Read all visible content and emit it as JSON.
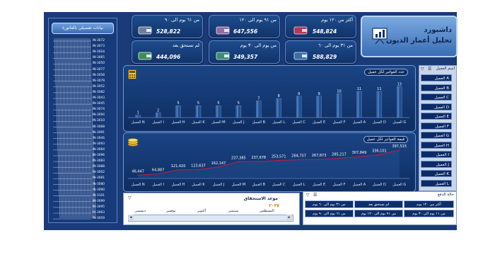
{
  "header": {
    "line1": "داشبورد",
    "line2": "تحلیل أعمار الدیون"
  },
  "kpis": [
    {
      "label": "أكثر من ١٢٠ يوم",
      "value": "548,824"
    },
    {
      "label": "من ٩١ يوم الى ١٢٠",
      "value": "647,556"
    },
    {
      "label": "من ٦١ يوم الى ٩٠",
      "value": "528,822"
    },
    {
      "label": "من ٣١ يوم الى ٦٠",
      "value": "588,829"
    },
    {
      "label": "من يوم الى ٣٠ يوم",
      "value": "349,357"
    },
    {
      "label": "لم تستحق بعد",
      "value": "444,096"
    }
  ],
  "invoice_panel": {
    "title": "بيانات تفصيلي بالفاتورة",
    "items": [
      "IN-3072",
      "IN-3073",
      "IN-3024",
      "IN-3065",
      "IN-3050",
      "IN-3077",
      "IN-3058",
      "IN-3079",
      "IN-3052",
      "IN-3082",
      "IN-3043",
      "IN-3045",
      "IN-3074",
      "IN-3094",
      "IN-3010",
      "IN-3068",
      "IN-3091",
      "IN-3046",
      "IN-3093",
      "IN-3064",
      "IN-3096",
      "IN-3083",
      "IN-3088",
      "IN-3002",
      "IN-3081",
      "IN-3080",
      "IN-3090",
      "IN-3101",
      "IN-3099",
      "IN-3095",
      "IN-3063",
      "IN-3059"
    ]
  },
  "client_slicer": {
    "title": "اسم العميل",
    "items": [
      "العميل A",
      "العميل B",
      "العميل C",
      "العميل D",
      "العميل E",
      "العميل F",
      "العميل G",
      "العميل H",
      "العميل I",
      "العميل J",
      "العميل K",
      "العميل L"
    ]
  },
  "count_chart": {
    "title": "عدد الفواتير لكل عميل"
  },
  "value_chart": {
    "title": "قيمة الفواتير لكل عميل"
  },
  "chart_data": [
    {
      "type": "bar",
      "title": "عدد الفواتير لكل عميل",
      "categories": [
        "العميل N",
        "العميل I",
        "العميل H",
        "العميل K",
        "العميل M",
        "العميل J",
        "العميل B",
        "العميل L",
        "العميل C",
        "العميل E",
        "العميل F",
        "العميل A",
        "العميل D",
        "العميل G"
      ],
      "values": [
        1,
        2,
        5,
        5,
        5,
        5,
        7,
        8,
        9,
        9,
        10,
        11,
        11,
        13
      ],
      "ylim": [
        0,
        14
      ]
    },
    {
      "type": "line",
      "title": "قيمة الفواتير لكل عميل",
      "categories": [
        "العميل N",
        "العميل I",
        "العميل H",
        "العميل K",
        "العميل J",
        "العميل M",
        "العميل B",
        "العميل C",
        "العميل L",
        "العميل E",
        "العميل F",
        "العميل A",
        "العميل D",
        "العميل G"
      ],
      "values": [
        46447,
        64887,
        121420,
        123637,
        162147,
        237385,
        237678,
        253571,
        264757,
        267873,
        285217,
        307849,
        336101,
        397515
      ],
      "labels": [
        "46,447",
        "64,887",
        "121,420",
        "123,637",
        "162,147",
        "237,385",
        "237,678",
        "253,571",
        "264,757",
        "267,873",
        "285,217",
        "307,849",
        "336,101",
        "397,515"
      ],
      "ylim": [
        0,
        420000
      ]
    }
  ],
  "due_panel": {
    "title": "موعد الاستحقاق",
    "year": "٢٠٢٥",
    "months": [
      "المسطس",
      "سبتمبر",
      "أكتوبر",
      "نوفمبر",
      "ديسمبر"
    ]
  },
  "status_slicer": {
    "title": "حالة الدفع",
    "items": [
      "أكثر من ١٢٠ يوم",
      "لم تستحق بعد",
      "من ٣١ يوم الى ٦٠ يوم",
      "من ١١ يوم الى ٣٠ يوم",
      "من ٩١ يوم الى ١٢٠ يوم",
      "من ٦١ يوم الى ٩٠ يوم"
    ]
  },
  "colors": {
    "background": "#1b3a78",
    "accent": "#8db4ea",
    "line": "#c0203a",
    "bar": "#23508f"
  }
}
